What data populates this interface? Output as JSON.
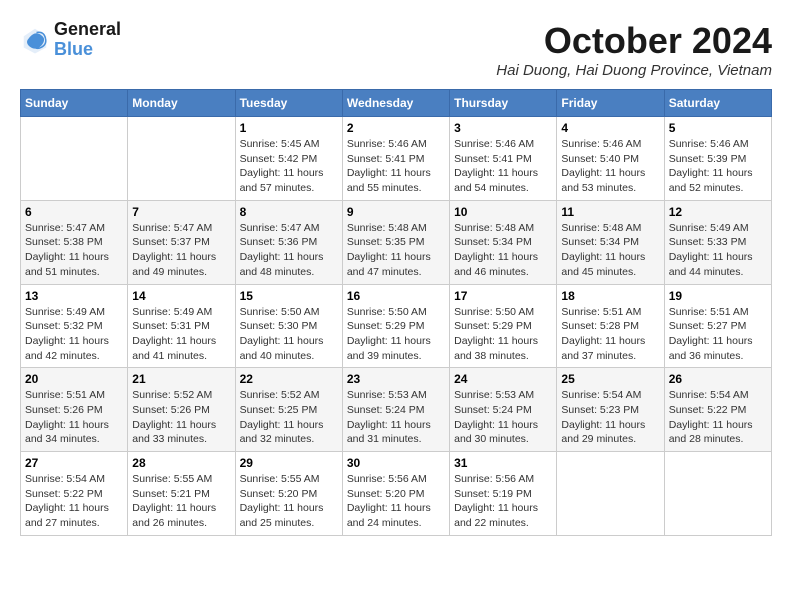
{
  "logo": {
    "line1": "General",
    "line2": "Blue"
  },
  "title": "October 2024",
  "location": "Hai Duong, Hai Duong Province, Vietnam",
  "weekdays": [
    "Sunday",
    "Monday",
    "Tuesday",
    "Wednesday",
    "Thursday",
    "Friday",
    "Saturday"
  ],
  "weeks": [
    [
      {
        "day": null,
        "info": null
      },
      {
        "day": null,
        "info": null
      },
      {
        "day": "1",
        "info": "Sunrise: 5:45 AM\nSunset: 5:42 PM\nDaylight: 11 hours\nand 57 minutes."
      },
      {
        "day": "2",
        "info": "Sunrise: 5:46 AM\nSunset: 5:41 PM\nDaylight: 11 hours\nand 55 minutes."
      },
      {
        "day": "3",
        "info": "Sunrise: 5:46 AM\nSunset: 5:41 PM\nDaylight: 11 hours\nand 54 minutes."
      },
      {
        "day": "4",
        "info": "Sunrise: 5:46 AM\nSunset: 5:40 PM\nDaylight: 11 hours\nand 53 minutes."
      },
      {
        "day": "5",
        "info": "Sunrise: 5:46 AM\nSunset: 5:39 PM\nDaylight: 11 hours\nand 52 minutes."
      }
    ],
    [
      {
        "day": "6",
        "info": "Sunrise: 5:47 AM\nSunset: 5:38 PM\nDaylight: 11 hours\nand 51 minutes."
      },
      {
        "day": "7",
        "info": "Sunrise: 5:47 AM\nSunset: 5:37 PM\nDaylight: 11 hours\nand 49 minutes."
      },
      {
        "day": "8",
        "info": "Sunrise: 5:47 AM\nSunset: 5:36 PM\nDaylight: 11 hours\nand 48 minutes."
      },
      {
        "day": "9",
        "info": "Sunrise: 5:48 AM\nSunset: 5:35 PM\nDaylight: 11 hours\nand 47 minutes."
      },
      {
        "day": "10",
        "info": "Sunrise: 5:48 AM\nSunset: 5:34 PM\nDaylight: 11 hours\nand 46 minutes."
      },
      {
        "day": "11",
        "info": "Sunrise: 5:48 AM\nSunset: 5:34 PM\nDaylight: 11 hours\nand 45 minutes."
      },
      {
        "day": "12",
        "info": "Sunrise: 5:49 AM\nSunset: 5:33 PM\nDaylight: 11 hours\nand 44 minutes."
      }
    ],
    [
      {
        "day": "13",
        "info": "Sunrise: 5:49 AM\nSunset: 5:32 PM\nDaylight: 11 hours\nand 42 minutes."
      },
      {
        "day": "14",
        "info": "Sunrise: 5:49 AM\nSunset: 5:31 PM\nDaylight: 11 hours\nand 41 minutes."
      },
      {
        "day": "15",
        "info": "Sunrise: 5:50 AM\nSunset: 5:30 PM\nDaylight: 11 hours\nand 40 minutes."
      },
      {
        "day": "16",
        "info": "Sunrise: 5:50 AM\nSunset: 5:29 PM\nDaylight: 11 hours\nand 39 minutes."
      },
      {
        "day": "17",
        "info": "Sunrise: 5:50 AM\nSunset: 5:29 PM\nDaylight: 11 hours\nand 38 minutes."
      },
      {
        "day": "18",
        "info": "Sunrise: 5:51 AM\nSunset: 5:28 PM\nDaylight: 11 hours\nand 37 minutes."
      },
      {
        "day": "19",
        "info": "Sunrise: 5:51 AM\nSunset: 5:27 PM\nDaylight: 11 hours\nand 36 minutes."
      }
    ],
    [
      {
        "day": "20",
        "info": "Sunrise: 5:51 AM\nSunset: 5:26 PM\nDaylight: 11 hours\nand 34 minutes."
      },
      {
        "day": "21",
        "info": "Sunrise: 5:52 AM\nSunset: 5:26 PM\nDaylight: 11 hours\nand 33 minutes."
      },
      {
        "day": "22",
        "info": "Sunrise: 5:52 AM\nSunset: 5:25 PM\nDaylight: 11 hours\nand 32 minutes."
      },
      {
        "day": "23",
        "info": "Sunrise: 5:53 AM\nSunset: 5:24 PM\nDaylight: 11 hours\nand 31 minutes."
      },
      {
        "day": "24",
        "info": "Sunrise: 5:53 AM\nSunset: 5:24 PM\nDaylight: 11 hours\nand 30 minutes."
      },
      {
        "day": "25",
        "info": "Sunrise: 5:54 AM\nSunset: 5:23 PM\nDaylight: 11 hours\nand 29 minutes."
      },
      {
        "day": "26",
        "info": "Sunrise: 5:54 AM\nSunset: 5:22 PM\nDaylight: 11 hours\nand 28 minutes."
      }
    ],
    [
      {
        "day": "27",
        "info": "Sunrise: 5:54 AM\nSunset: 5:22 PM\nDaylight: 11 hours\nand 27 minutes."
      },
      {
        "day": "28",
        "info": "Sunrise: 5:55 AM\nSunset: 5:21 PM\nDaylight: 11 hours\nand 26 minutes."
      },
      {
        "day": "29",
        "info": "Sunrise: 5:55 AM\nSunset: 5:20 PM\nDaylight: 11 hours\nand 25 minutes."
      },
      {
        "day": "30",
        "info": "Sunrise: 5:56 AM\nSunset: 5:20 PM\nDaylight: 11 hours\nand 24 minutes."
      },
      {
        "day": "31",
        "info": "Sunrise: 5:56 AM\nSunset: 5:19 PM\nDaylight: 11 hours\nand 22 minutes."
      },
      {
        "day": null,
        "info": null
      },
      {
        "day": null,
        "info": null
      }
    ]
  ]
}
